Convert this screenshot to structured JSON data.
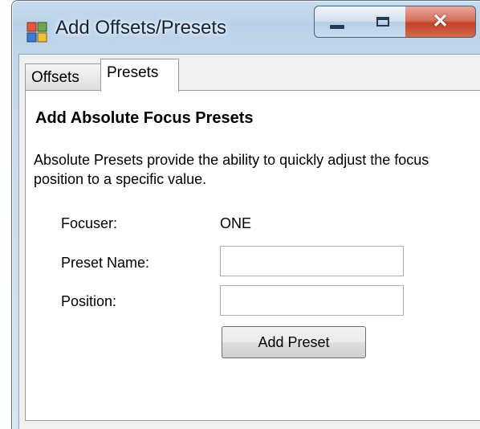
{
  "window": {
    "title": "Add Offsets/Presets",
    "icon": "windows-form-icon",
    "controls": {
      "minimize": "minimize-icon",
      "maximize": "maximize-icon",
      "close_label": "✕"
    }
  },
  "tabs": [
    {
      "label": "Offsets",
      "selected": false
    },
    {
      "label": "Presets",
      "selected": true
    }
  ],
  "presets_tab": {
    "heading": "Add Absolute Focus Presets",
    "description": "Absolute Presets provide the ability to quickly adjust the focus position to a specific value.",
    "focuser_label": "Focuser:",
    "focuser_value": "ONE",
    "preset_name_label": "Preset Name:",
    "preset_name_value": "",
    "position_label": "Position:",
    "position_value": "",
    "add_button": "Add Preset"
  },
  "colors": {
    "titlebar": "#b9d1e7",
    "close_button": "#c4422a",
    "client_bg": "#f0f0f0",
    "panel_bg": "#ffffff"
  }
}
